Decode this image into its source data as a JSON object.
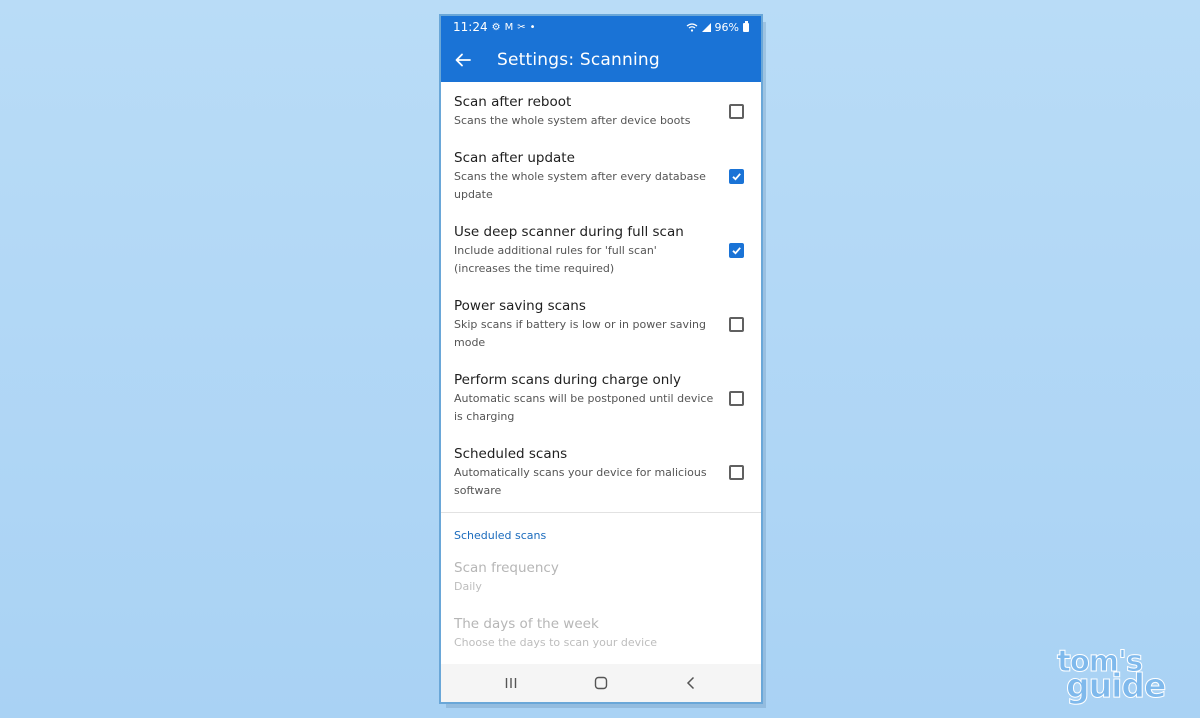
{
  "status_bar": {
    "time": "11:24",
    "battery": "96%",
    "left_icons": [
      "gear-icon",
      "gmail-icon",
      "tools-icon",
      "dot-icon"
    ],
    "right_icons": [
      "wifi-icon",
      "signal-icon",
      "battery-icon"
    ]
  },
  "appbar": {
    "title": "Settings: Scanning",
    "back_icon": "arrow-left-icon"
  },
  "settings": [
    {
      "title": "Scan after reboot",
      "desc": "Scans the whole system after device boots",
      "checked": false
    },
    {
      "title": "Scan after update",
      "desc": "Scans the whole system after every database update",
      "checked": true
    },
    {
      "title": "Use deep scanner during full scan",
      "desc": "Include additional rules for 'full scan' (increases the time required)",
      "checked": true
    },
    {
      "title": "Power saving scans",
      "desc": "Skip scans if battery is low or in power saving mode",
      "checked": false
    },
    {
      "title": "Perform scans during charge only",
      "desc": "Automatic scans will be postponed until device is charging",
      "checked": false
    },
    {
      "title": "Scheduled scans",
      "desc": "Automatically scans your device for malicious software",
      "checked": false
    }
  ],
  "scheduled_section": {
    "header": "Scheduled scans",
    "items": [
      {
        "title": "Scan frequency",
        "desc": "Daily"
      },
      {
        "title": "The days of the week",
        "desc": "Choose the days to scan your device"
      }
    ]
  },
  "nav_bar": {
    "icons": [
      "recent-apps-icon",
      "home-icon",
      "back-icon"
    ]
  },
  "watermark": {
    "line1": "tom's",
    "line2": "guide"
  },
  "colors": {
    "primary": "#1a73d6",
    "section_header": "#1a6bbd",
    "background": "#b9dcf7"
  }
}
